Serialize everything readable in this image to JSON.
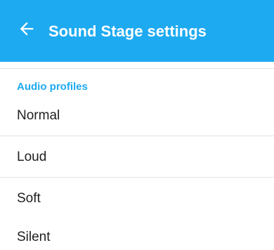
{
  "appbar": {
    "title": "Sound Stage settings",
    "back_icon": "arrow-left-icon",
    "background": "#1eaaf1"
  },
  "section": {
    "header": "Audio profiles",
    "header_color": "#1eaaf1",
    "items": [
      {
        "label": "Normal"
      },
      {
        "label": "Loud"
      },
      {
        "label": "Soft"
      },
      {
        "label": "Silent"
      }
    ]
  }
}
